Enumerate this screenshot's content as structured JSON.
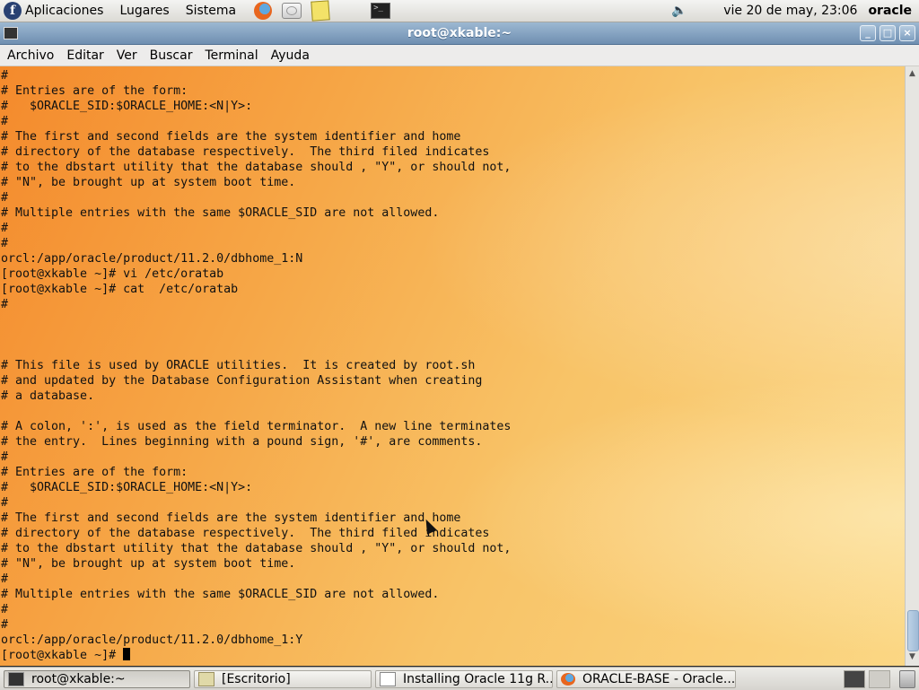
{
  "top_panel": {
    "menus": [
      "Aplicaciones",
      "Lugares",
      "Sistema"
    ],
    "clock": "vie 20 de may, 23:06",
    "user": "oracle"
  },
  "window": {
    "title": "root@xkable:~"
  },
  "menubar": [
    "Archivo",
    "Editar",
    "Ver",
    "Buscar",
    "Terminal",
    "Ayuda"
  ],
  "terminal": {
    "lines": [
      "#",
      "# Entries are of the form:",
      "#   $ORACLE_SID:$ORACLE_HOME:<N|Y>:",
      "#",
      "# The first and second fields are the system identifier and home",
      "# directory of the database respectively.  The third filed indicates",
      "# to the dbstart utility that the database should , \"Y\", or should not,",
      "# \"N\", be brought up at system boot time.",
      "#",
      "# Multiple entries with the same $ORACLE_SID are not allowed.",
      "#",
      "#",
      "orcl:/app/oracle/product/11.2.0/dbhome_1:N",
      "[root@xkable ~]# vi /etc/oratab",
      "[root@xkable ~]# cat  /etc/oratab",
      "#",
      "",
      "",
      "",
      "# This file is used by ORACLE utilities.  It is created by root.sh",
      "# and updated by the Database Configuration Assistant when creating",
      "# a database.",
      "",
      "# A colon, ':', is used as the field terminator.  A new line terminates",
      "# the entry.  Lines beginning with a pound sign, '#', are comments.",
      "#",
      "# Entries are of the form:",
      "#   $ORACLE_SID:$ORACLE_HOME:<N|Y>:",
      "#",
      "# The first and second fields are the system identifier and home",
      "# directory of the database respectively.  The third filed indicates",
      "# to the dbstart utility that the database should , \"Y\", or should not,",
      "# \"N\", be brought up at system boot time.",
      "#",
      "# Multiple entries with the same $ORACLE_SID are not allowed.",
      "#",
      "#",
      "orcl:/app/oracle/product/11.2.0/dbhome_1:Y"
    ],
    "prompt": "[root@xkable ~]# "
  },
  "taskbar": {
    "tasks": [
      {
        "label": "root@xkable:~",
        "icon": "terminal-icon",
        "active": true
      },
      {
        "label": "[Escritorio]",
        "icon": "folder-icon",
        "active": false
      },
      {
        "label": "Installing Oracle 11g R...",
        "icon": "document-icon",
        "active": false
      },
      {
        "label": "ORACLE-BASE - Oracle...",
        "icon": "firefox-icon",
        "active": false
      }
    ]
  },
  "colors": {
    "titlebar": "#7f9fc0",
    "terminal_bg_start": "#f48a2c",
    "terminal_bg_end": "#fbd784"
  }
}
